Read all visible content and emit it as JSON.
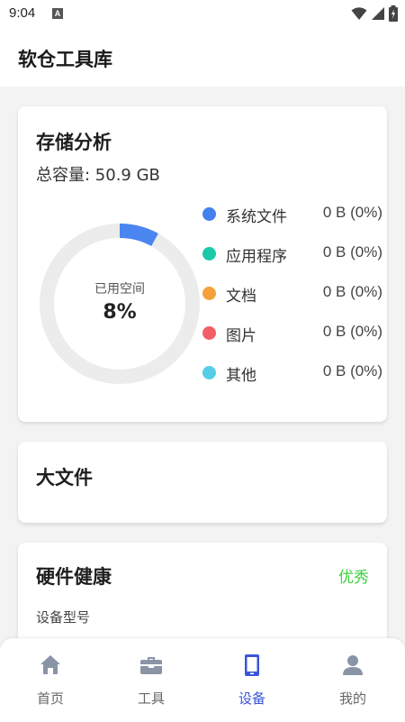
{
  "status_bar": {
    "time": "9:04",
    "badge": "A"
  },
  "app": {
    "title": "软仓工具库"
  },
  "storage": {
    "title": "存储分析",
    "total_capacity": "总容量: 50.9 GB",
    "used_label": "已用空间",
    "used_percent_text": "8%",
    "used_fraction": 0.08,
    "ring_track_color": "#ececec",
    "ring_fill_color": "#4a85f0",
    "categories": [
      {
        "name": "系统文件",
        "value": "0 B (0%)",
        "color": "#4580ef"
      },
      {
        "name": "应用程序",
        "value": "0 B (0%)",
        "color": "#1bc9a8"
      },
      {
        "name": "文档",
        "value": "0 B (0%)",
        "color": "#f5a03c"
      },
      {
        "name": "图片",
        "value": "0 B (0%)",
        "color": "#f25f66"
      },
      {
        "name": "其他",
        "value": "0 B (0%)",
        "color": "#55cde6"
      }
    ]
  },
  "big_files": {
    "title": "大文件"
  },
  "hardware": {
    "title": "硬件健康",
    "status": "优秀",
    "status_color": "#3cd13c",
    "device_model_label": "设备型号"
  },
  "nav": {
    "items": [
      {
        "label": "首页",
        "icon": "home-icon"
      },
      {
        "label": "工具",
        "icon": "toolbox-icon"
      },
      {
        "label": "设备",
        "icon": "phone-icon"
      },
      {
        "label": "我的",
        "icon": "person-icon"
      }
    ],
    "active_index": 2,
    "active_color": "#3b55d9",
    "inactive_color": "#8a94a6"
  }
}
